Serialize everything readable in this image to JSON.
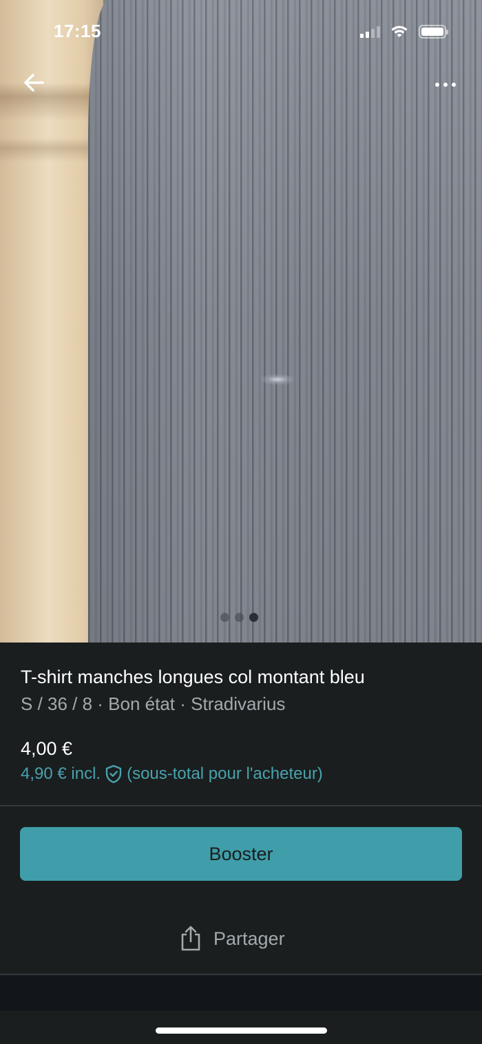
{
  "status_bar": {
    "time": "17:15",
    "signal_bars_filled": 2,
    "signal_bars_total": 4
  },
  "photo": {
    "carousel_total": 3,
    "carousel_active_index": 2
  },
  "item": {
    "title": "T-shirt manches longues col montant bleu",
    "subtitle": "S / 36 / 8 · Bon état · Stradivarius",
    "price": "4,00 €",
    "price_incl_amount": "4,90 € incl.",
    "price_incl_note": "(sous-total pour l'acheteur)"
  },
  "actions": {
    "booster_label": "Booster",
    "share_label": "Partager"
  },
  "colors": {
    "accent": "#3f9ea9",
    "accent_text": "#49a2ad",
    "background": "#1a1e1f",
    "muted_text": "#a3aaad"
  },
  "icons": {
    "back": "arrow-left-icon",
    "more": "more-horizontal-icon",
    "buyer_protection": "shield-check-icon",
    "share": "share-icon",
    "wifi": "wifi-icon",
    "battery": "battery-icon",
    "signal": "signal-icon"
  }
}
